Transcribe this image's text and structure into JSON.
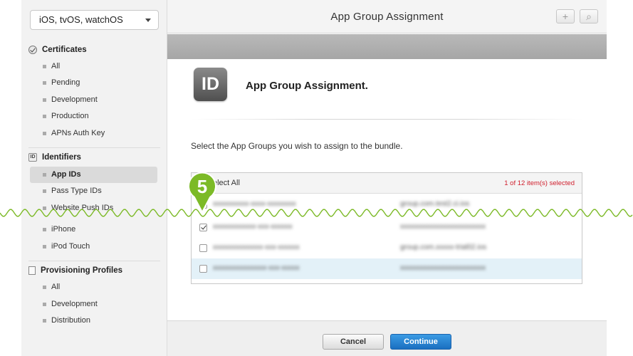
{
  "sidebar": {
    "platform": "iOS, tvOS, watchOS",
    "sections": {
      "certificates": {
        "title": "Certificates",
        "items": [
          "All",
          "Pending",
          "Development",
          "Production",
          "APNs Auth Key"
        ]
      },
      "identifiers": {
        "title": "Identifiers",
        "icon_text": "ID",
        "items": [
          "App IDs",
          "Pass Type IDs",
          "Website Push IDs",
          "iPhone",
          "iPod Touch"
        ],
        "selected": "App IDs"
      },
      "profiles": {
        "title": "Provisioning Profiles",
        "items": [
          "All",
          "Development",
          "Distribution"
        ]
      }
    }
  },
  "header": {
    "title": "App Group Assignment",
    "add_icon": "+",
    "search_icon": "⌕"
  },
  "main": {
    "badge_text": "ID",
    "title": "App Group Assignment.",
    "instruction": "Select the App Groups you wish to assign to the bundle.",
    "table": {
      "select_all_label": "elect All",
      "selected_count": "1 of 12 item(s) selected",
      "rows": [
        {
          "checked": false,
          "name": "xxxxxxxxxx-xxxx-xxxxxxxx",
          "id": "group.com.test2.ci.ios"
        },
        {
          "checked": true,
          "name": "xxxxxxxxxxxx-xxx-xxxxxx",
          "id": "xxxxxxxxxxxxxxxxxxxxxxxx"
        },
        {
          "checked": false,
          "name": "xxxxxxxxxxxxxx-xxx-xxxxxx",
          "id": "group.com.xxxxx-trial02.ios"
        },
        {
          "checked": false,
          "name": "xxxxxxxxxxxxxxx-xxx-xxxxx",
          "id": "xxxxxxxxxxxxxxxxxxxxxxxx"
        }
      ]
    }
  },
  "footer": {
    "cancel_label": "Cancel",
    "continue_label": "Continue"
  },
  "step_marker": "5",
  "colors": {
    "accent": "#1a6fc0",
    "marker_green": "#7cba27",
    "selected_count_red": "#d0202e",
    "row_highlight": "#e3f1f8"
  }
}
